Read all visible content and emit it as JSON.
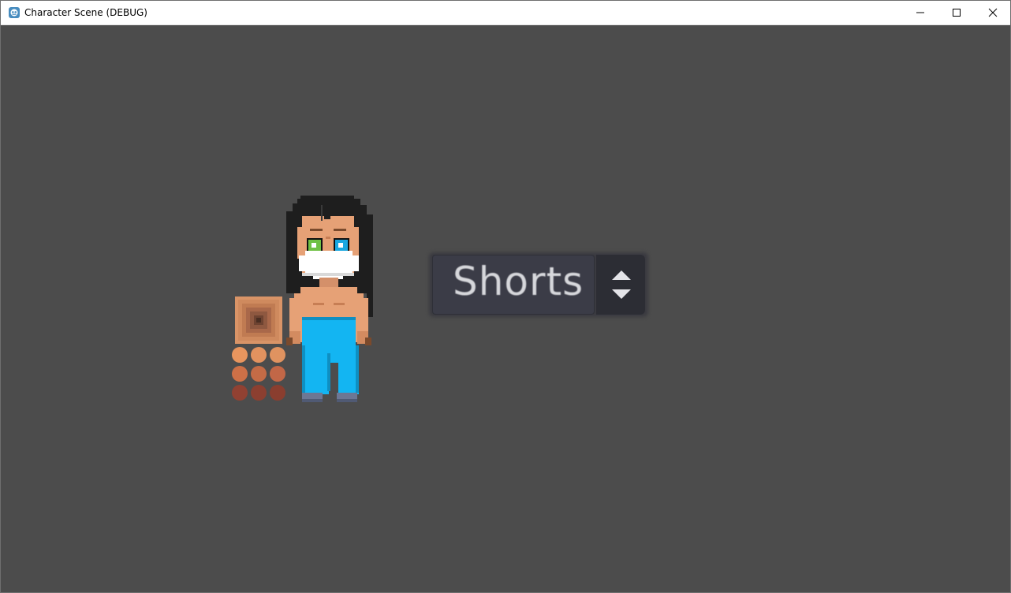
{
  "window": {
    "title": "Character Scene (DEBUG)",
    "icon": "godot-engine-icon",
    "controls": [
      "minimize-icon",
      "maximize-icon",
      "close-icon"
    ]
  },
  "scene": {
    "background_color": "#4c4c4c",
    "clothing_option": {
      "selected": "Shorts",
      "arrow_icon": "up-down-arrows-icon"
    },
    "skin_tone_swatches": [
      "#e8955e",
      "#e2925f",
      "#e09360",
      "#cd7047",
      "#c46b46",
      "#c26747",
      "#914132",
      "#8c3f30",
      "#8a3e2f"
    ],
    "character_colors": {
      "hair": "#1e1e1e",
      "skin": "#e6a176",
      "pants": "#13b5f2",
      "mask": "#ffffff",
      "eye_left": "#6fc144",
      "eye_right": "#1aa7e0",
      "shoes": "#6d7794"
    }
  }
}
